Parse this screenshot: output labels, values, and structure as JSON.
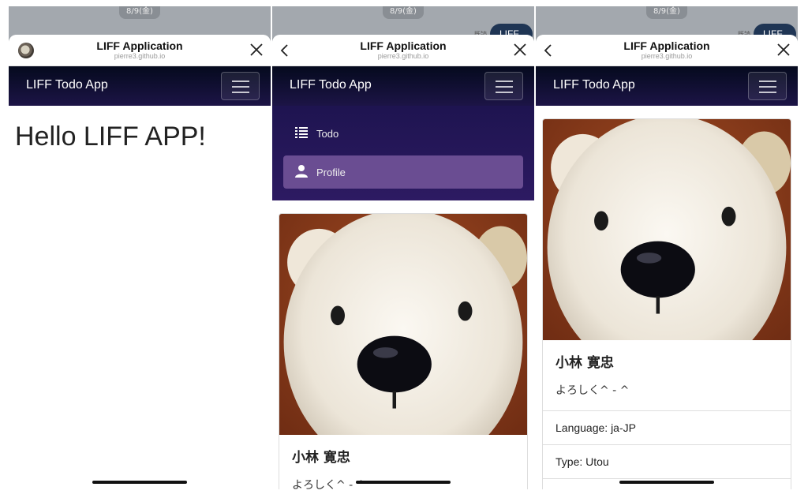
{
  "chat": {
    "date": "8/9(金)",
    "read_mark": "既読",
    "bubble_text": "LIFF"
  },
  "liff": {
    "title": "LIFF Application",
    "domain": "pierre3.github.io"
  },
  "navbar": {
    "brand": "LIFF Todo App"
  },
  "home": {
    "heading": "Hello LIFF APP!"
  },
  "menu": {
    "items": [
      {
        "label": "Todo",
        "icon": "list-icon"
      },
      {
        "label": "Profile",
        "icon": "user-icon"
      }
    ]
  },
  "profile": {
    "name": "小林 寛忠",
    "bio": "よろしく^ - ^",
    "language": "Language: ja-JP",
    "type": "Type: Utou"
  },
  "colors": {
    "navbar": "#0b0f2a",
    "menu": "#24175a",
    "menu_active": "#6a4d92"
  }
}
